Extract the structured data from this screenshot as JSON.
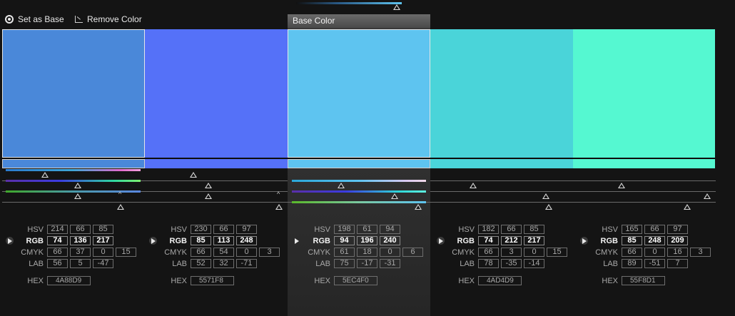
{
  "toolbar": {
    "set_base_label": "Set as Base",
    "remove_color_label": "Remove Color"
  },
  "base_header_label": "Base Color",
  "labels": {
    "hsv": "HSV",
    "rgb": "RGB",
    "cmyk": "CMYK",
    "lab": "LAB",
    "hex": "HEX"
  },
  "swatches": [
    {
      "color": "#4A88D9",
      "strip_color": "#4A88D9",
      "selected": true,
      "hsv": [
        "214",
        "66",
        "85"
      ],
      "rgb": [
        "74",
        "136",
        "217"
      ],
      "cmyk": [
        "66",
        "37",
        "0",
        "15"
      ],
      "lab": [
        "56",
        "5",
        "-47"
      ],
      "hex": "4A88D9"
    },
    {
      "color": "#5571F8",
      "strip_color": "#5571F8",
      "selected": false,
      "hsv": [
        "230",
        "66",
        "97"
      ],
      "rgb": [
        "85",
        "113",
        "248"
      ],
      "cmyk": [
        "66",
        "54",
        "0",
        "3"
      ],
      "lab": [
        "52",
        "32",
        "-71"
      ],
      "hex": "5571F8"
    },
    {
      "color": "#5EC4F0",
      "strip_color": "#5EC4F0",
      "selected": true,
      "hsv": [
        "198",
        "61",
        "94"
      ],
      "rgb": [
        "94",
        "196",
        "240"
      ],
      "cmyk": [
        "61",
        "18",
        "0",
        "6"
      ],
      "lab": [
        "75",
        "-17",
        "-31"
      ],
      "hex": "5EC4F0"
    },
    {
      "color": "#4AD4D9",
      "strip_color": "#4AD4D9",
      "selected": false,
      "hsv": [
        "182",
        "66",
        "85"
      ],
      "rgb": [
        "74",
        "212",
        "217"
      ],
      "cmyk": [
        "66",
        "3",
        "0",
        "15"
      ],
      "lab": [
        "78",
        "-35",
        "-14"
      ],
      "hex": "4AD4D9"
    },
    {
      "color": "#55F8D1",
      "strip_color": "#55F8D1",
      "selected": false,
      "hsv": [
        "165",
        "66",
        "97"
      ],
      "rgb": [
        "85",
        "248",
        "209"
      ],
      "cmyk": [
        "66",
        "0",
        "16",
        "3"
      ],
      "lab": [
        "89",
        "-51",
        "7"
      ],
      "hex": "55F8D1"
    }
  ]
}
